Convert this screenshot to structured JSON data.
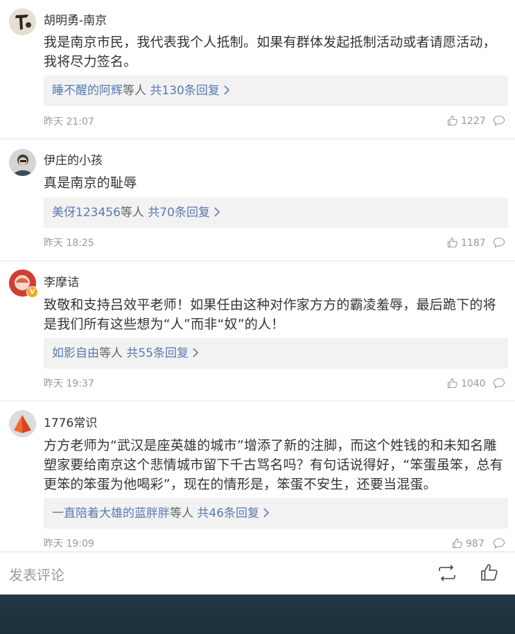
{
  "comments": [
    {
      "name": "胡明勇-南京",
      "text": "我是南京市民，我代表我个人抵制。如果有群体发起抵制活动或者请愿活动，我将尽力签名。",
      "reply_users": "睡不醒的阿辉",
      "reply_mid": "等人",
      "reply_count": "共130条回复",
      "time": "昨天 21:07",
      "likes": "1227",
      "avatar_icon": "portrait-icon"
    },
    {
      "name": "伊庄的小孩",
      "text": "真是南京的耻辱",
      "reply_users": "美伢123456",
      "reply_mid": "等人",
      "reply_count": "共70条回复",
      "time": "昨天 18:25",
      "likes": "1187",
      "avatar_icon": "portrait-icon"
    },
    {
      "name": "李摩诘",
      "text": "致敬和支持吕效平老师！如果任由这种对作家方方的霸凌羞辱，最后跪下的将是我们所有这些想为“人”而非“奴”的人！",
      "reply_users": "如影自由",
      "reply_mid": "等人",
      "reply_count": "共55条回复",
      "time": "昨天 19:37",
      "likes": "1040",
      "avatar_icon": "portrait-icon",
      "verified_mark": "V"
    },
    {
      "name": "1776常识",
      "text": "方方老师为“武汉是座英雄的城市”增添了新的注脚，而这个姓钱的和未知名雕塑家要给南京这个悲情城市留下千古骂名吗？有句话说得好，“笨蛋虽笨，总有更笨的笨蛋为他喝彩”，现在的情形是，笨蛋不安生，还要当混蛋。",
      "reply_users": "一直陪着大雄的蓝胖胖",
      "reply_mid": "等人",
      "reply_count": "共46条回复",
      "time": "昨天 19:09",
      "likes": "987",
      "avatar_icon": "pyramid-icon"
    }
  ],
  "bottom_bar": {
    "comment_placeholder": "发表评论",
    "share_icon": "share-icon",
    "like_icon": "thumbs-up-icon"
  },
  "colors": {
    "link_blue": "#5a7ab0",
    "footer_dark": "#233744",
    "reply_bg": "#f2f2f2"
  }
}
